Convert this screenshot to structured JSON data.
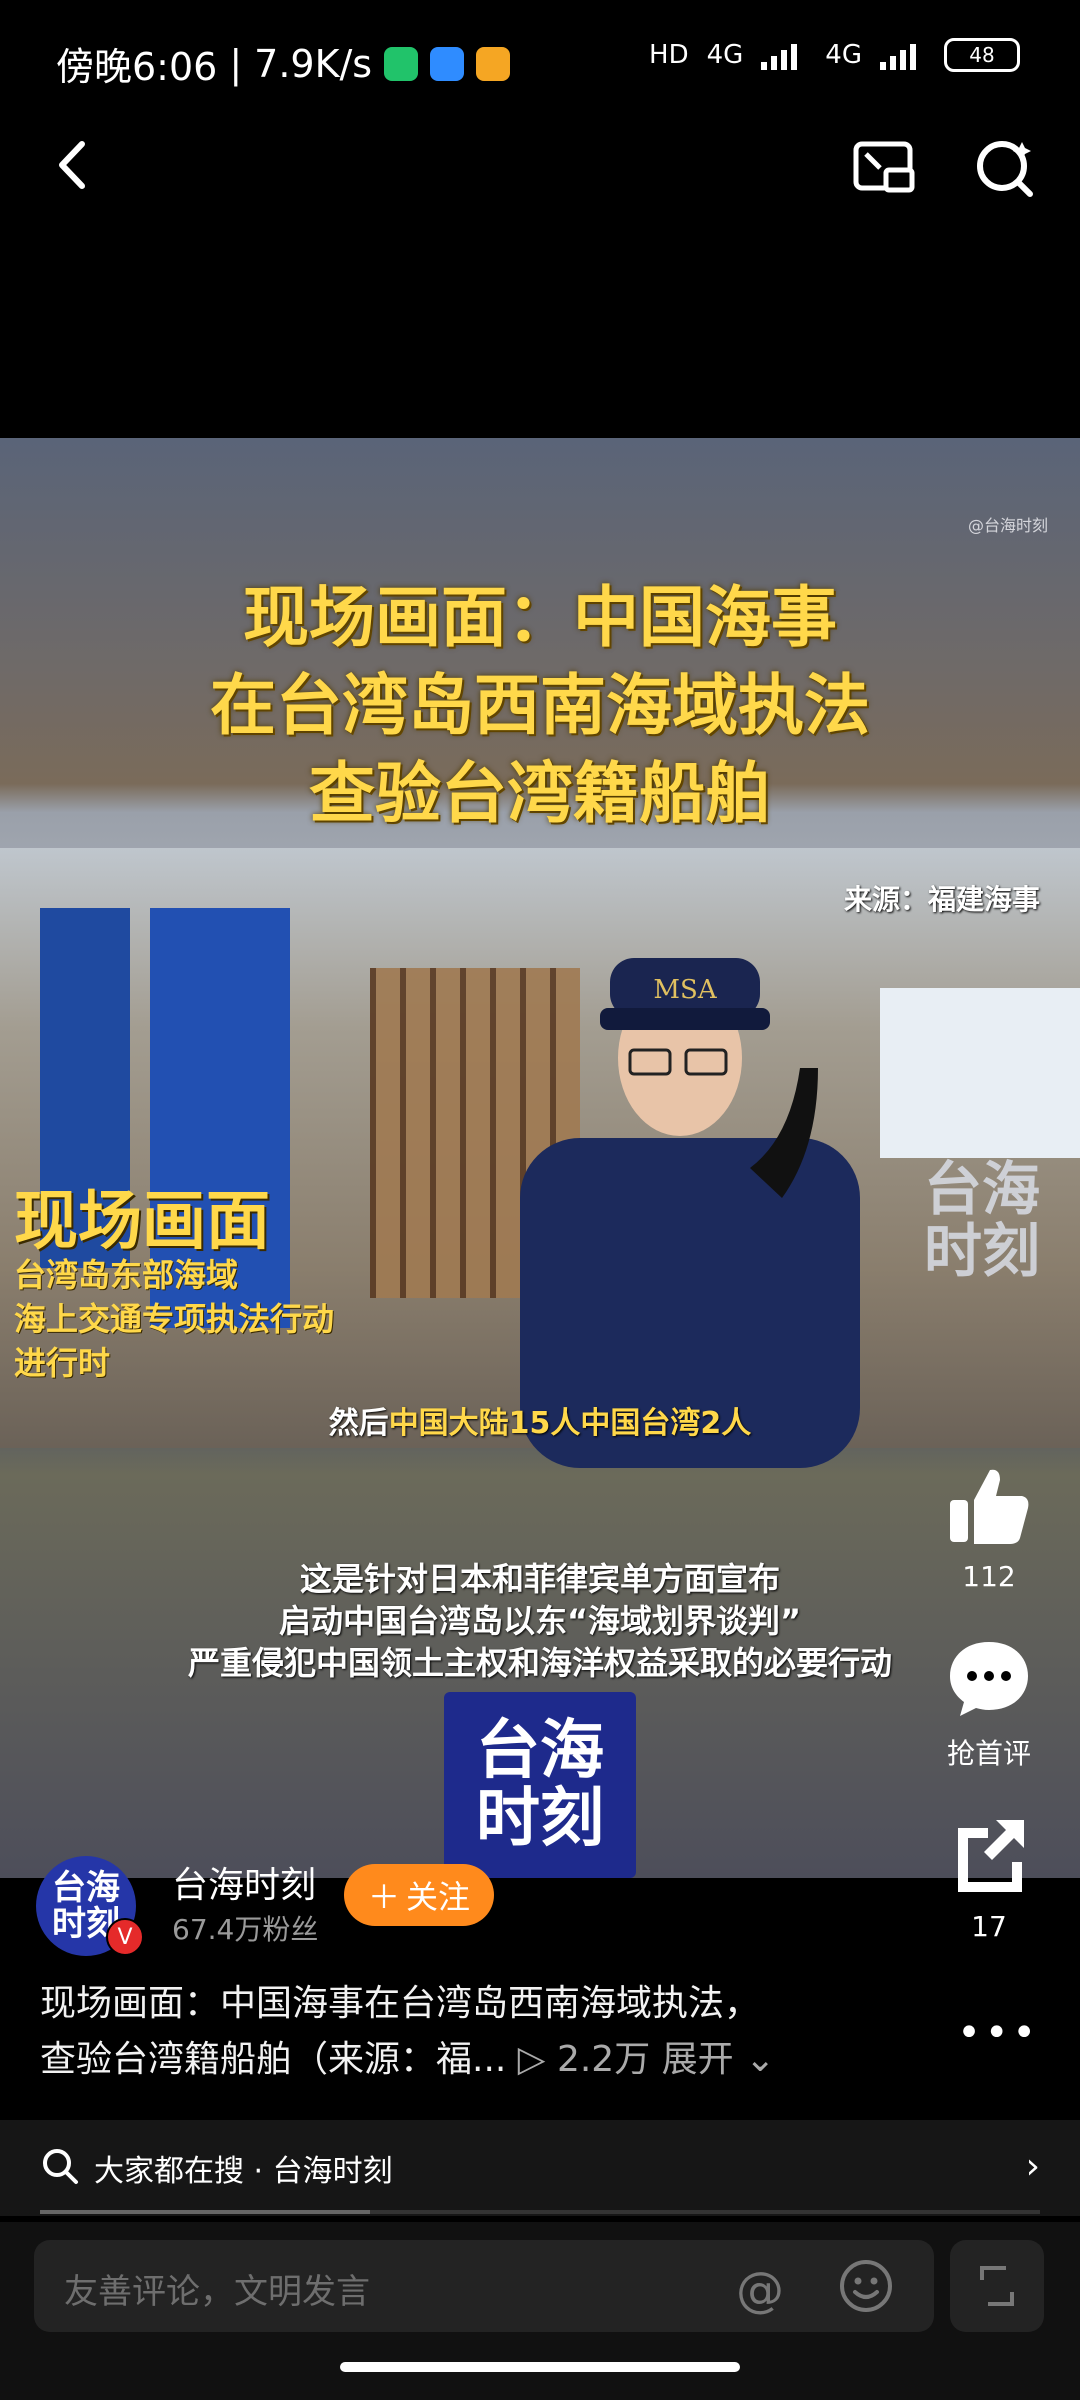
{
  "status_bar": {
    "time": "傍晚6:06",
    "speed": "7.9K/s",
    "network1": "HD",
    "network2": "4G",
    "network3": "4G",
    "battery": "48"
  },
  "video": {
    "watermark": "@台海时刻",
    "headline_lines": [
      "现场画面：中国海事",
      "在台湾岛西南海域执法",
      "查验台湾籍船舶"
    ],
    "source": "来源：福建海事",
    "live_title": "现场画面",
    "live_sub_lines": [
      "台湾岛东部海域",
      "海上交通专项执法行动",
      "进行时"
    ],
    "caption_prefix": "然后",
    "caption_highlight": "中国大陆15人中国台湾2人",
    "bottom_lines": [
      "这是针对日本和菲律宾单方面宣布",
      "启动中国台湾岛以东“海域划界谈判”",
      "严重侵犯中国领土主权和海洋权益采取的必要行动"
    ],
    "logo_lines": [
      "台海",
      "时刻"
    ],
    "cap_text": "MSA"
  },
  "side_actions": {
    "like_count": "112",
    "comment_label": "抢首评",
    "share_count": "17"
  },
  "author": {
    "avatar_lines": [
      "台海",
      "时刻"
    ],
    "verified": "V",
    "name": "台海时刻",
    "fans": "67.4万粉丝",
    "follow_label": "关注"
  },
  "description": {
    "line1": "现场画面：中国海事在台湾岛西南海域执法，",
    "line2": "查验台湾籍船舶（来源：福...",
    "views": "2.2万",
    "expand": "展开"
  },
  "hot_search": {
    "text": "大家都在搜 · 台海时刻",
    "progress": 0.33
  },
  "comment": {
    "placeholder": "友善评论，文明发言"
  },
  "colors": {
    "accent": "#ff8a1c",
    "headline": "#ffd84a",
    "logo_blue": "#1e2a8c"
  }
}
